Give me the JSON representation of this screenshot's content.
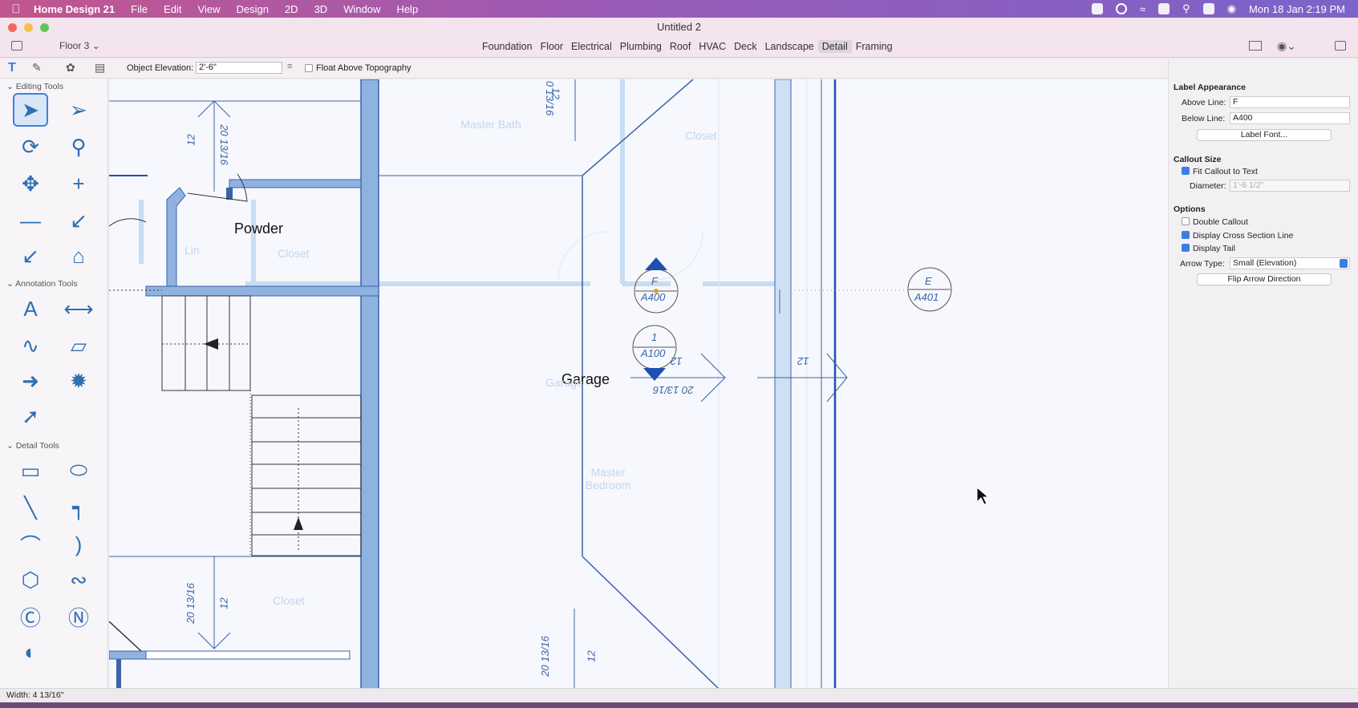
{
  "menubar": {
    "app_name": "Home Design 21",
    "items": [
      "File",
      "Edit",
      "View",
      "Design",
      "2D",
      "3D",
      "Window",
      "Help"
    ],
    "datetime": "Mon 18 Jan  2:19 PM"
  },
  "window": {
    "title": "Untitled 2"
  },
  "toolbar": {
    "floor_selector": "Floor 3",
    "view_tabs": [
      "Foundation",
      "Floor",
      "Electrical",
      "Plumbing",
      "Roof",
      "HVAC",
      "Deck",
      "Landscape",
      "Detail",
      "Framing"
    ],
    "active_view": "Detail"
  },
  "toolbar2": {
    "object_elevation_label": "Object Elevation:",
    "object_elevation_value": "2'-6\"",
    "float_above_label": "Float Above Topography"
  },
  "left_panel": {
    "sections": [
      "Editing Tools",
      "Annotation Tools",
      "Detail Tools"
    ]
  },
  "canvas": {
    "room_labels": [
      "Powder",
      "Garage"
    ],
    "faint_labels": [
      "Master Bath",
      "Closet",
      "Lin",
      "Closet",
      "Master Bedroom",
      "Closet",
      "Garage"
    ],
    "callouts": [
      {
        "above": "F",
        "below": "A400"
      },
      {
        "above": "1",
        "below": "A100"
      },
      {
        "above": "E",
        "below": "A401"
      }
    ],
    "dimensions": [
      "12",
      "20 13/16",
      "0 13/16",
      "12",
      "20 13/16",
      "12",
      "12",
      "20 13/16",
      "12",
      "20 13/16",
      "12"
    ]
  },
  "right_panel": {
    "label_appearance": "Label Appearance",
    "above_line_label": "Above Line:",
    "above_line_value": "F",
    "below_line_label": "Below Line:",
    "below_line_value": "A400",
    "label_font_button": "Label Font...",
    "callout_size": "Callout Size",
    "fit_callout_label": "Fit Callout to Text",
    "diameter_label": "Diameter:",
    "diameter_value": "1'-6 1/2\"",
    "options": "Options",
    "double_callout": "Double Callout",
    "display_cross_section": "Display Cross Section Line",
    "display_tail": "Display Tail",
    "arrow_type_label": "Arrow Type:",
    "arrow_type_value": "Small (Elevation)",
    "flip_arrow_button": "Flip Arrow Direction"
  },
  "status": {
    "text": "Width: 4 13/16\""
  }
}
